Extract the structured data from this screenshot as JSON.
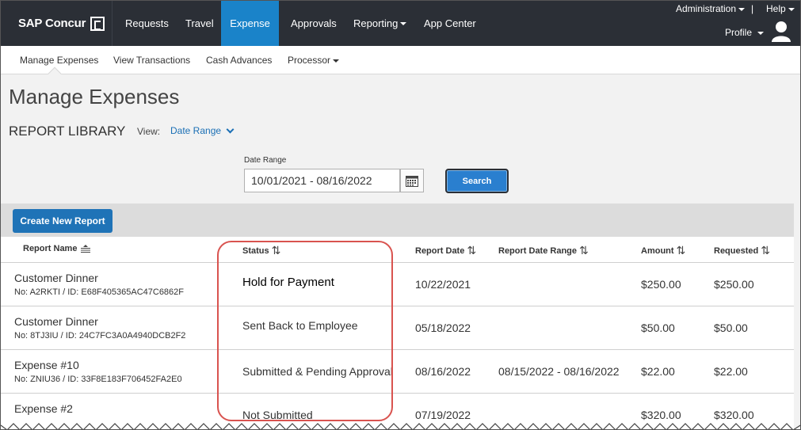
{
  "brand": {
    "name": "SAP Concur"
  },
  "topnav": {
    "items": [
      {
        "label": "Requests"
      },
      {
        "label": "Travel"
      },
      {
        "label": "Expense"
      },
      {
        "label": "Approvals"
      },
      {
        "label": "Reporting"
      },
      {
        "label": "App Center"
      }
    ],
    "administration": "Administration",
    "separator": "|",
    "help": "Help",
    "profile": "Profile"
  },
  "subnav": {
    "items": [
      {
        "label": "Manage Expenses"
      },
      {
        "label": "View Transactions"
      },
      {
        "label": "Cash Advances"
      },
      {
        "label": "Processor"
      }
    ]
  },
  "page": {
    "title": "Manage Expenses",
    "section": "REPORT LIBRARY",
    "view_label": "View:",
    "view_value": "Date Range"
  },
  "filter": {
    "date_range_label": "Date Range",
    "date_range_value": "10/01/2021 - 08/16/2022",
    "search_label": "Search"
  },
  "toolbar": {
    "create_label": "Create New Report"
  },
  "table": {
    "headers": {
      "name": "Report Name",
      "status": "Status",
      "date": "Report Date",
      "range": "Report Date Range",
      "amount": "Amount",
      "requested": "Requested"
    },
    "rows": [
      {
        "name": "Customer Dinner",
        "id": "No: A2RKTI / ID: E68F405365AC47C6862F",
        "status": "Hold for Payment",
        "date": "10/22/2021",
        "range": "",
        "amount": "$250.00",
        "requested": "$250.00"
      },
      {
        "name": "Customer Dinner",
        "id": "No: 8TJ3IU / ID: 24C7FC3A0A4940DCB2F2",
        "status": "Sent Back to Employee",
        "date": "05/18/2022",
        "range": "",
        "amount": "$50.00",
        "requested": "$50.00"
      },
      {
        "name": "Expense #10",
        "id": "No: ZNIU36 / ID: 33F8E183F706452FA2E0",
        "status": "Submitted & Pending Approval",
        "date": "08/16/2022",
        "range": "08/15/2022 - 08/16/2022",
        "amount": "$22.00",
        "requested": "$22.00"
      },
      {
        "name": "Expense #2",
        "id": "",
        "status": "Not Submitted",
        "date": "07/19/2022",
        "range": "",
        "amount": "$320.00",
        "requested": "$320.00"
      }
    ]
  },
  "colors": {
    "nav_bg": "#2b2f36",
    "accent": "#1a83c9",
    "button": "#1f73b7",
    "highlight": "#d9534f"
  }
}
